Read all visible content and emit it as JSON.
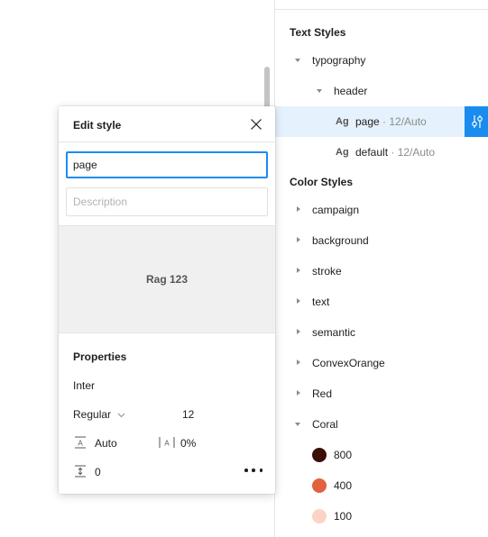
{
  "text_styles": {
    "title": "Text Styles",
    "groups": [
      {
        "label": "typography"
      },
      {
        "label": "header"
      }
    ],
    "items": [
      {
        "ag": "Ag",
        "name": "page",
        "meta": " · 12/Auto"
      },
      {
        "ag": "Ag",
        "name": "default",
        "meta": " · 12/Auto"
      }
    ]
  },
  "color_styles": {
    "title": "Color Styles",
    "groups": [
      {
        "label": "campaign"
      },
      {
        "label": "background"
      },
      {
        "label": "stroke"
      },
      {
        "label": "text"
      },
      {
        "label": "semantic"
      },
      {
        "label": "ConvexOrange"
      },
      {
        "label": "Red"
      },
      {
        "label": "Coral"
      }
    ],
    "swatches": [
      {
        "label": "800",
        "color": "#3b0e07"
      },
      {
        "label": "400",
        "color": "#e0623f"
      },
      {
        "label": "100",
        "color": "#fbd3c7"
      }
    ]
  },
  "edit_style": {
    "title": "Edit style",
    "name_value": "page",
    "description_placeholder": "Description",
    "preview_text": "Rag 123",
    "properties_title": "Properties",
    "font_family": "Inter",
    "font_weight": "Regular",
    "font_size": "12",
    "line_height": "Auto",
    "letter_spacing": "0%",
    "paragraph_spacing": "0"
  },
  "colors": {
    "accent": "#1a8cf0",
    "selected_row": "#e5f1fd"
  }
}
